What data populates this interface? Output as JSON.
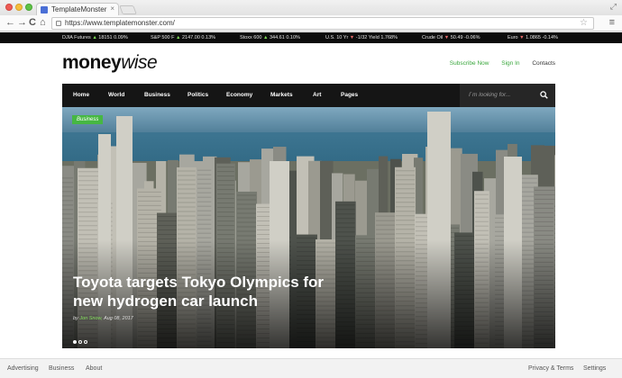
{
  "browser": {
    "tab_title": "TemplateMonster",
    "tab_close": "×",
    "url": "https://www.templatemonster.com/",
    "back": "←",
    "forward": "→",
    "reload": "C",
    "home": "⌂",
    "star": "☆",
    "menu": "≡",
    "expand": "⤢"
  },
  "ticker": [
    {
      "name": "DJIA Futures",
      "value": "18151",
      "change": "0.09%",
      "dir": "up"
    },
    {
      "name": "S&P 500 F",
      "value": "2147.00",
      "change": "0.13%",
      "dir": "up"
    },
    {
      "name": "Stoxx 600",
      "value": "344.61",
      "change": "0.10%",
      "dir": "up"
    },
    {
      "name": "U.S. 10 Yr",
      "value": "-1/32 Yield",
      "change": "1.768%",
      "dir": "dn"
    },
    {
      "name": "Crude Oil",
      "value": "50.49",
      "change": "-0.06%",
      "dir": "dn"
    },
    {
      "name": "Euro",
      "value": "1.0865",
      "change": "-0.14%",
      "dir": "dn"
    }
  ],
  "logo": {
    "bold": "money",
    "italic": "wise"
  },
  "top_links": {
    "subscribe": "Subscribe Now",
    "signin": "Sign In",
    "contacts": "Contacts"
  },
  "nav": {
    "items": [
      "Home",
      "World",
      "Business",
      "Politics",
      "Economy",
      "Markets",
      "Art",
      "Pages"
    ],
    "search_placeholder": "I`m looking for..."
  },
  "hero": {
    "category": "Business",
    "headline": "Toyota targets Tokyo Olympics for new hydrogen car launch",
    "byline_prefix": "by",
    "author": "Jon Snow,",
    "date": "Aug 08, 2017"
  },
  "footer": {
    "advertising": "Advertising",
    "business": "Business",
    "about": "About",
    "privacy": "Privacy & Terms",
    "settings": "Settings"
  },
  "colors": {
    "accent_green": "#46b743",
    "nav_bg": "#151515"
  }
}
